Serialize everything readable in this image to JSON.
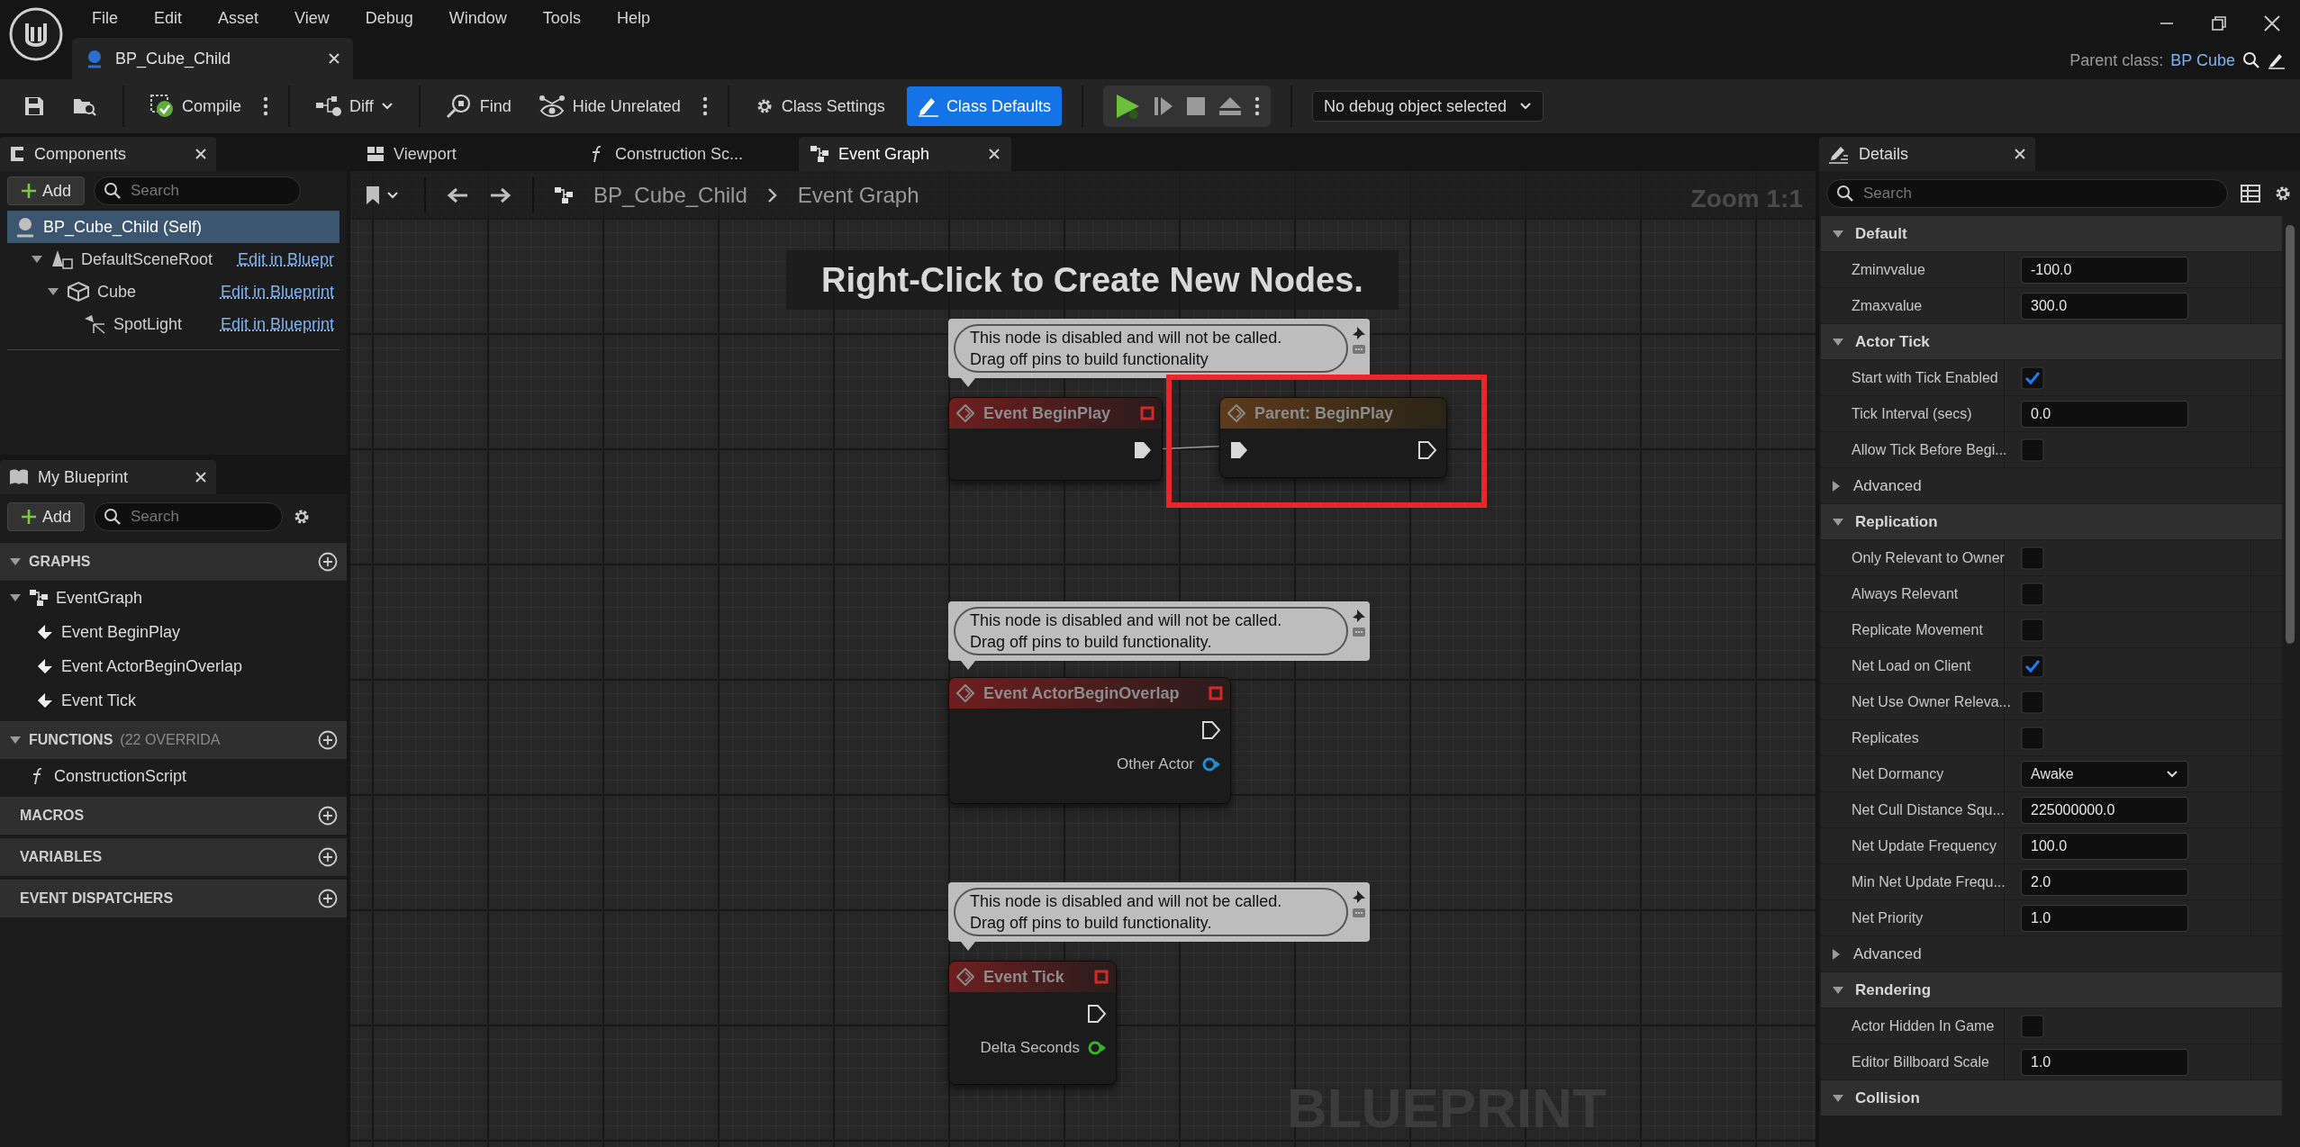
{
  "menu": [
    "File",
    "Edit",
    "Asset",
    "View",
    "Debug",
    "Window",
    "Tools",
    "Help"
  ],
  "document_tab": {
    "label": "BP_Cube_Child"
  },
  "parent_class": {
    "label": "Parent class:",
    "value": "BP Cube"
  },
  "toolbar": {
    "compile": "Compile",
    "diff": "Diff",
    "find": "Find",
    "hide_unrelated": "Hide Unrelated",
    "class_settings": "Class Settings",
    "class_defaults": {
      "label": "Class Defaults",
      "selected": true
    },
    "debug_object": "No debug object selected"
  },
  "components": {
    "title": "Components",
    "add": "Add",
    "search_placeholder": "Search",
    "tree": [
      {
        "kind": "actor",
        "label": "BP_Cube_Child (Self)",
        "selected": true,
        "children": [
          {
            "kind": "scene-root",
            "label": "DefaultSceneRoot",
            "link": "Edit in Bluepr",
            "selected": false,
            "expanded": true,
            "children": [
              {
                "kind": "mesh",
                "label": "Cube",
                "link": "Edit in Blueprint",
                "selected": false,
                "expanded": true,
                "children": [
                  {
                    "kind": "light",
                    "label": "SpotLight",
                    "link": "Edit in Blueprint",
                    "selected": false
                  }
                ]
              }
            ]
          }
        ]
      }
    ]
  },
  "my_blueprint": {
    "title": "My Blueprint",
    "add": "Add",
    "search_placeholder": "Search",
    "sections": [
      {
        "title": "GRAPHS",
        "items": [
          {
            "kind": "graph",
            "label": "EventGraph",
            "expanded": true,
            "children": [
              {
                "kind": "event",
                "label": "Event BeginPlay"
              },
              {
                "kind": "event",
                "label": "Event ActorBeginOverlap"
              },
              {
                "kind": "event",
                "label": "Event Tick"
              }
            ]
          }
        ]
      },
      {
        "title": "FUNCTIONS",
        "note": "(22 OVERRIDA",
        "items": [
          {
            "kind": "function",
            "label": "ConstructionScript"
          }
        ]
      },
      {
        "title": "MACROS"
      },
      {
        "title": "VARIABLES"
      },
      {
        "title": "EVENT DISPATCHERS"
      }
    ]
  },
  "graph_tabs": [
    {
      "kind": "viewport",
      "label": "Viewport",
      "selected": false
    },
    {
      "kind": "function",
      "label": "Construction Sc...",
      "selected": false
    },
    {
      "kind": "graph",
      "label": "Event Graph",
      "selected": true
    }
  ],
  "breadcrumb": [
    "BP_Cube_Child",
    "Event Graph"
  ],
  "graph": {
    "hint": "Right-Click to Create New Nodes.",
    "zoom": "Zoom 1:1",
    "watermark": "BLUEPRINT",
    "nodes": [
      {
        "kind": "event",
        "title": "Event BeginPlay",
        "comment": [
          "This node is disabled and will not be called.",
          "Drag off pins to build functionality"
        ],
        "pins": [
          {
            "kind": "exec-out",
            "connected": true
          }
        ]
      },
      {
        "kind": "call",
        "title": "Parent: BeginPlay",
        "pins": [
          {
            "kind": "exec-in",
            "connected": true
          },
          {
            "kind": "exec-out",
            "connected": false
          }
        ]
      },
      {
        "kind": "event",
        "title": "Event ActorBeginOverlap",
        "comment": [
          "This node is disabled and will not be called.",
          "Drag off pins to build functionality."
        ],
        "pins": [
          {
            "kind": "exec-out",
            "connected": false
          },
          {
            "kind": "data",
            "label": "Other Actor",
            "color": "#1e90d6",
            "connected": false
          }
        ]
      },
      {
        "kind": "event",
        "title": "Event Tick",
        "comment": [
          "This node is disabled and will not be called.",
          "Drag off pins to build functionality."
        ],
        "pins": [
          {
            "kind": "exec-out",
            "connected": false
          },
          {
            "kind": "data",
            "label": "Delta Seconds",
            "color": "#36b52b",
            "connected": false
          }
        ]
      }
    ]
  },
  "details": {
    "title": "Details",
    "search_placeholder": "Search",
    "sections": [
      {
        "title": "Default",
        "expanded": true,
        "rows": [
          {
            "kind": "number",
            "label": "Zminvvalue",
            "value": "-100.0"
          },
          {
            "kind": "number",
            "label": "Zmaxvalue",
            "value": "300.0"
          }
        ]
      },
      {
        "title": "Actor Tick",
        "expanded": true,
        "rows": [
          {
            "kind": "checkbox",
            "label": "Start with Tick Enabled",
            "checked": true
          },
          {
            "kind": "number",
            "label": "Tick Interval (secs)",
            "value": "0.0"
          },
          {
            "kind": "checkbox",
            "label": "Allow Tick Before Begi...",
            "checked": false
          },
          {
            "kind": "group",
            "label": "Advanced",
            "expanded": false
          }
        ]
      },
      {
        "title": "Replication",
        "expanded": true,
        "rows": [
          {
            "kind": "checkbox",
            "label": "Only Relevant to Owner",
            "checked": false
          },
          {
            "kind": "checkbox",
            "label": "Always Relevant",
            "checked": false
          },
          {
            "kind": "checkbox",
            "label": "Replicate Movement",
            "checked": false
          },
          {
            "kind": "checkbox",
            "label": "Net Load on Client",
            "checked": true
          },
          {
            "kind": "checkbox",
            "label": "Net Use Owner Releva...",
            "checked": false
          },
          {
            "kind": "checkbox",
            "label": "Replicates",
            "checked": false
          },
          {
            "kind": "dropdown",
            "label": "Net Dormancy",
            "value": "Awake"
          },
          {
            "kind": "number",
            "label": "Net Cull Distance Squ...",
            "value": "225000000.0"
          },
          {
            "kind": "number",
            "label": "Net Update Frequency",
            "value": "100.0"
          },
          {
            "kind": "number",
            "label": "Min Net Update Frequ...",
            "value": "2.0"
          },
          {
            "kind": "number",
            "label": "Net Priority",
            "value": "1.0"
          },
          {
            "kind": "group",
            "label": "Advanced",
            "expanded": false
          }
        ]
      },
      {
        "title": "Rendering",
        "expanded": true,
        "rows": [
          {
            "kind": "checkbox",
            "label": "Actor Hidden In Game",
            "checked": false
          },
          {
            "kind": "number",
            "label": "Editor Billboard Scale",
            "value": "1.0"
          }
        ]
      },
      {
        "title": "Collision",
        "expanded": true
      }
    ]
  }
}
